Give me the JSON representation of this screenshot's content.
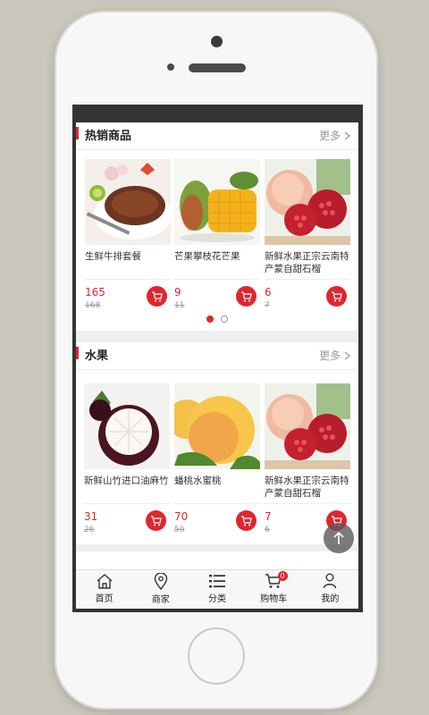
{
  "sections": [
    {
      "title": "热销商品",
      "more": "更多",
      "products": [
        {
          "name": "生鲜牛排套餐",
          "price": "165",
          "old_price": "168"
        },
        {
          "name": "芒果攀枝花芒果",
          "price": "9",
          "old_price": "11"
        },
        {
          "name": "新鲜水果正宗云南特产蒙自甜石榴",
          "price": "6",
          "old_price": "7"
        }
      ]
    },
    {
      "title": "水果",
      "more": "更多",
      "products": [
        {
          "name": "新鲜山竹进口油麻竹",
          "price": "31",
          "old_price": "26"
        },
        {
          "name": "蟠桃水蜜桃",
          "price": "70",
          "old_price": "59"
        },
        {
          "name": "新鲜水果正宗云南特产蒙自甜石榴",
          "price": "7",
          "old_price": "6"
        }
      ]
    }
  ],
  "carousel": {
    "active": 1,
    "count": 2
  },
  "tabbar": {
    "items": [
      {
        "label": "首页",
        "icon": "home-icon"
      },
      {
        "label": "商家",
        "icon": "location-pin-icon"
      },
      {
        "label": "分类",
        "icon": "list-icon"
      },
      {
        "label": "购物车",
        "icon": "cart-icon",
        "badge": "0"
      },
      {
        "label": "我的",
        "icon": "person-icon"
      }
    ]
  },
  "colors": {
    "accent": "#e0262d",
    "background": "#efefef"
  }
}
